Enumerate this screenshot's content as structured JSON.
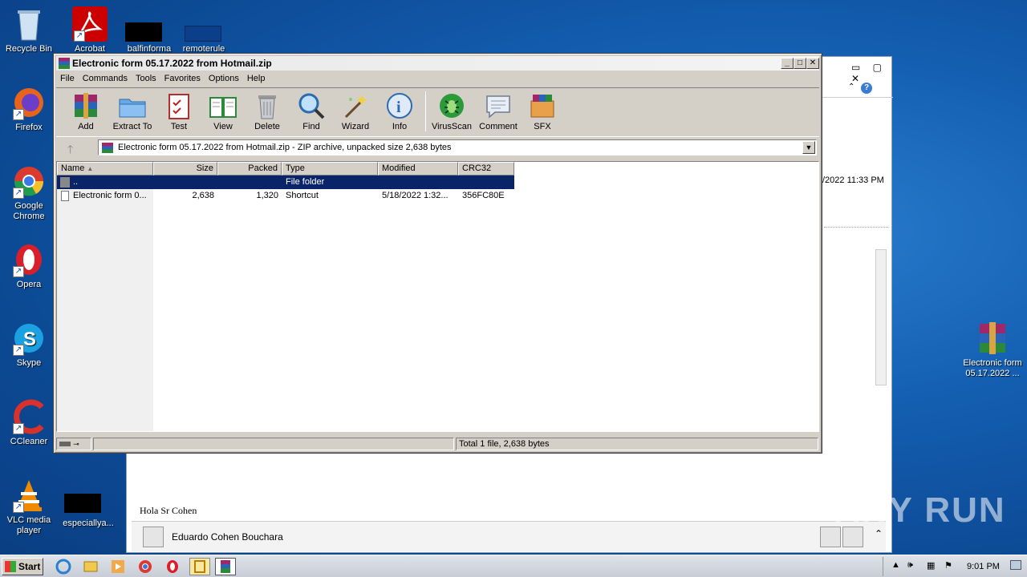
{
  "desktop": {
    "icons_left": [
      {
        "label": "Recycle Bin",
        "icon": "recycle-bin-icon"
      },
      {
        "label": "Firefox",
        "icon": "firefox-icon"
      },
      {
        "label": "Google Chrome",
        "icon": "chrome-icon"
      },
      {
        "label": "Opera",
        "icon": "opera-icon"
      },
      {
        "label": "Skype",
        "icon": "skype-icon"
      },
      {
        "label": "CCleaner",
        "icon": "ccleaner-icon"
      },
      {
        "label": "VLC media player",
        "icon": "vlc-icon"
      }
    ],
    "icons_top": [
      {
        "label": "Acrobat",
        "icon": "acrobat-icon"
      },
      {
        "label": "balfinforma",
        "icon": "file-icon"
      },
      {
        "label": "remoterule",
        "icon": "file-icon"
      }
    ],
    "icon_bottom": {
      "label": "especiallya...",
      "icon": "file-icon"
    },
    "icon_right": {
      "label": "Electronic form 05.17.2022 ...",
      "icon": "winrar-icon"
    }
  },
  "bg_window": {
    "date_text": "/2022 11:33 PM",
    "body_text": "Hola Sr Cohen",
    "sender": "Eduardo Cohen Bouchara"
  },
  "winrar": {
    "title": "Electronic form 05.17.2022 from Hotmail.zip",
    "menu": [
      "File",
      "Commands",
      "Tools",
      "Favorites",
      "Options",
      "Help"
    ],
    "toolbar": [
      "Add",
      "Extract To",
      "Test",
      "View",
      "Delete",
      "Find",
      "Wizard",
      "Info",
      "VirusScan",
      "Comment",
      "SFX"
    ],
    "address": "Electronic form 05.17.2022 from Hotmail.zip - ZIP archive, unpacked size 2,638 bytes",
    "columns": [
      "Name",
      "Size",
      "Packed",
      "Type",
      "Modified",
      "CRC32"
    ],
    "rows": [
      {
        "name": "..",
        "size": "",
        "packed": "",
        "type": "File folder",
        "modified": "",
        "crc": ""
      },
      {
        "name": "Electronic form 0...",
        "size": "2,638",
        "packed": "1,320",
        "type": "Shortcut",
        "modified": "5/18/2022 1:32...",
        "crc": "356FC80E"
      }
    ],
    "status": "Total 1 file, 2,638 bytes"
  },
  "taskbar": {
    "start": "Start",
    "clock": "9:01 PM"
  },
  "watermark": "ANY RUN"
}
